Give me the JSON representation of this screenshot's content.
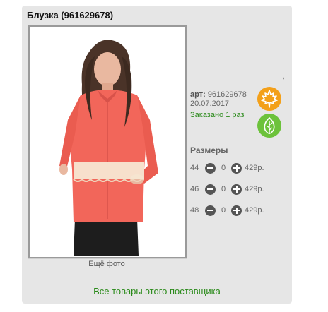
{
  "product": {
    "title": "Блузка (961629678)",
    "art_label": "арт:",
    "art_value": "961629678",
    "date": "20.07.2017",
    "ordered": "Заказано 1 раз",
    "more_photos": "Ещё фото",
    "mark": ","
  },
  "badges": [
    {
      "name": "autumn-season-badge",
      "icon": "maple-leaf-icon",
      "color": "#f3a01a"
    },
    {
      "name": "eco-badge",
      "icon": "leaf-icon",
      "color": "#6cc23b"
    }
  ],
  "sizes": {
    "title": "Размеры",
    "rows": [
      {
        "size": "44",
        "qty": "0",
        "price": "429р."
      },
      {
        "size": "46",
        "qty": "0",
        "price": "429р."
      },
      {
        "size": "48",
        "qty": "0",
        "price": "429р."
      }
    ]
  },
  "supplier_link": "Все товары этого поставщика",
  "photo": {
    "subject": "blouse-photo",
    "blouse_color": "#f2665a",
    "lace_color": "#f7e7d3"
  }
}
